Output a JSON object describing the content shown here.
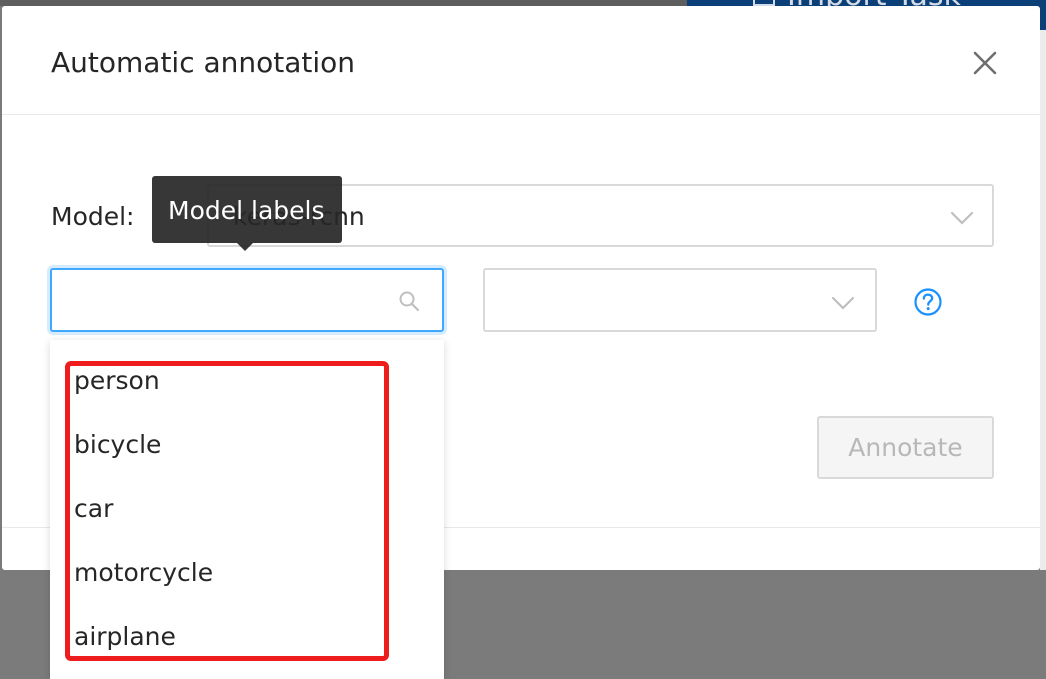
{
  "background": {
    "import_button_label": "Import Task"
  },
  "dialog": {
    "title": "Automatic annotation",
    "model_label": "Model:",
    "model_value": "keras-rcnn",
    "tooltip": "Model labels",
    "label_search_placeholder": "",
    "label_search_value": "",
    "mapping_select_value": "",
    "annotate_label": "Annotate"
  },
  "labels_dropdown": {
    "items": [
      "person",
      "bicycle",
      "car",
      "motorcycle",
      "airplane"
    ]
  },
  "colors": {
    "accent": "#1890ff",
    "focus_border": "#40a9ff",
    "annotation_highlight": "#ee1c1c",
    "tooltip_bg": "#262626",
    "import_button": "#0b3f78"
  },
  "icons": {
    "close": "close-icon",
    "model_dropdown": "chevron-down-icon",
    "search": "search-icon",
    "mapping_dropdown": "chevron-down-icon",
    "help": "question-circle-icon"
  }
}
